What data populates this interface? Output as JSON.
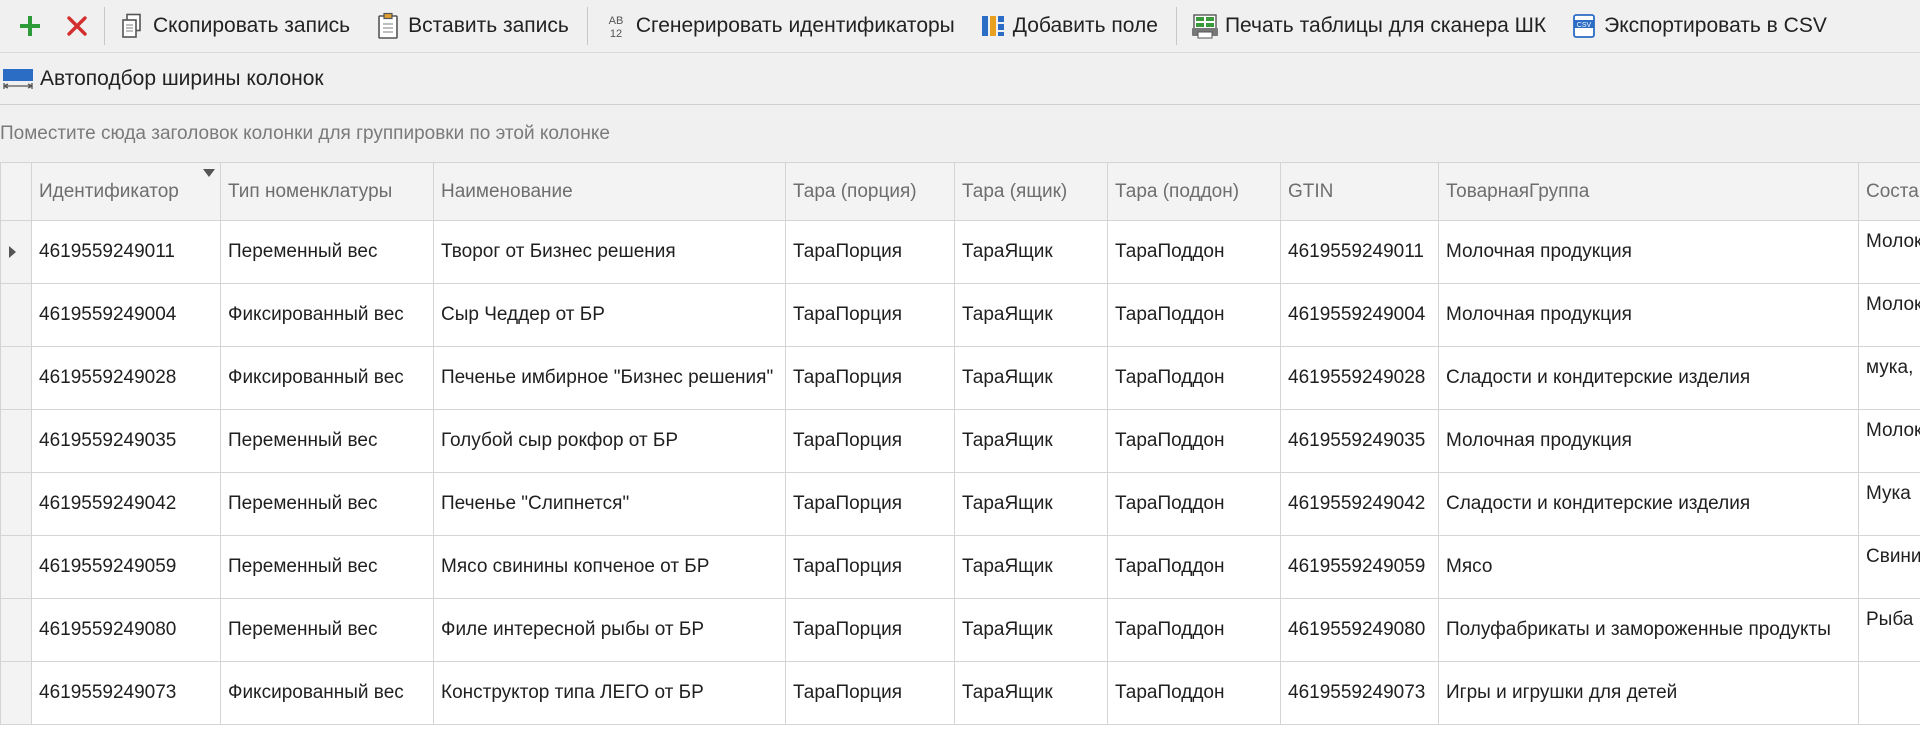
{
  "toolbar": {
    "copy_label": "Скопировать запись",
    "paste_label": "Вставить запись",
    "generate_label": "Сгенерировать идентификаторы",
    "generate_icon_text": "AB12",
    "add_field_label": "Добавить поле",
    "print_label": "Печать таблицы для сканера ШК",
    "export_label": "Экспортировать в CSV",
    "export_icon_text": "CSV"
  },
  "toolbar2": {
    "autofit_label": "Автоподбор ширины колонок"
  },
  "group_panel": {
    "hint": "Поместите сюда заголовок колонки для группировки по этой колонке"
  },
  "colors": {
    "add_green": "#2e9b3a",
    "delete_red": "#d32f2f",
    "accent_blue": "#2b6cc4"
  },
  "grid": {
    "columns": [
      "Идентификатор",
      "Тип номенклатуры",
      "Наименование",
      "Тара (порция)",
      "Тара (ящик)",
      "Тара (поддон)",
      "GTIN",
      "ТоварнаяГруппа",
      "Соста"
    ],
    "rows": [
      [
        "4619559249011",
        "Переменный вес",
        "Творог от Бизнес решения",
        "ТараПорция",
        "ТараЯщик",
        "ТараПоддон",
        "4619559249011",
        "Молочная продукция",
        "Молок"
      ],
      [
        "4619559249004",
        "Фиксированный вес",
        "Сыр Чеддер от БР",
        "ТараПорция",
        "ТараЯщик",
        "ТараПоддон",
        "4619559249004",
        "Молочная продукция",
        "Молок"
      ],
      [
        "4619559249028",
        "Фиксированный вес",
        "Печенье имбирное \"Бизнес решения\"",
        "ТараПорция",
        "ТараЯщик",
        "ТараПоддон",
        "4619559249028",
        "Сладости и кондитерские изделия",
        "мука,"
      ],
      [
        "4619559249035",
        "Переменный вес",
        "Голубой сыр рокфор от БР",
        "ТараПорция",
        "ТараЯщик",
        "ТараПоддон",
        "4619559249035",
        "Молочная продукция",
        "Молок"
      ],
      [
        "4619559249042",
        "Переменный вес",
        "Печенье \"Слипнется\"",
        "ТараПорция",
        "ТараЯщик",
        "ТараПоддон",
        "4619559249042",
        "Сладости и кондитерские изделия",
        "Мука"
      ],
      [
        "4619559249059",
        "Переменный вес",
        "Мясо свинины копченое от БР",
        "ТараПорция",
        "ТараЯщик",
        "ТараПоддон",
        "4619559249059",
        "Мясо",
        "Свини"
      ],
      [
        "4619559249080",
        "Переменный вес",
        "Филе интересной рыбы от БР",
        "ТараПорция",
        "ТараЯщик",
        "ТараПоддон",
        "4619559249080",
        "Полуфабрикаты и замороженные продукты",
        "Рыба"
      ],
      [
        "4619559249073",
        "Фиксированный вес",
        "Конструктор типа ЛЕГО от БР",
        "ТараПорция",
        "ТараЯщик",
        "ТараПоддон",
        "4619559249073",
        "Игры и игрушки для детей",
        ""
      ]
    ]
  }
}
